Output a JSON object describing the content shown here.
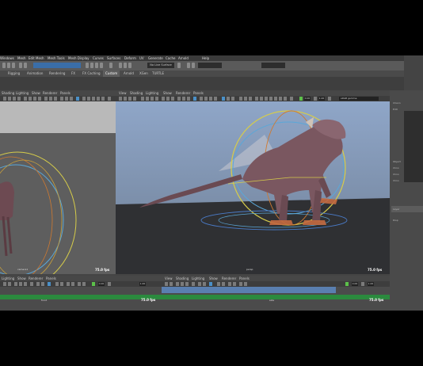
{
  "menubar": {
    "items": [
      "Windows",
      "Mesh",
      "Edit Mesh",
      "Mesh Tools",
      "Mesh Display",
      "Curves",
      "Surfaces",
      "Deform",
      "UV",
      "Generate",
      "Cache",
      "Arnold",
      "Help"
    ]
  },
  "status": {
    "field_value": "No Live Surface"
  },
  "shelf_tabs": {
    "items": [
      "Rigging",
      "Animation",
      "Rendering",
      "FX",
      "FX Caching",
      "Custom",
      "Arnold",
      "XGen",
      "TURTLE"
    ],
    "active": "Custom"
  },
  "panels": {
    "left_menu": [
      "Shading",
      "Lighting",
      "Show",
      "Renderer",
      "Panels"
    ],
    "main_menu": [
      "View",
      "Shading",
      "Lighting",
      "Show",
      "Renderer",
      "Panels"
    ],
    "bottom_left_menu": [
      "Lighting",
      "Show",
      "Renderer",
      "Panels"
    ],
    "bottom_right_menu": [
      "View",
      "Shading",
      "Lighting",
      "Show",
      "Renderer",
      "Panels"
    ]
  },
  "toolbar_fields": {
    "value_a": "0.00",
    "value_b": "1.00",
    "colorspace": "sRGB gamma"
  },
  "viewports": {
    "left_camera": "camera1",
    "left_fps": "75.0 fps",
    "main_camera": "persp",
    "main_fps": "75.0 fps",
    "bottom_left_camera": "front",
    "bottom_left_fps": "75.0 fps",
    "bottom_right_camera": "side",
    "bottom_right_fps": "75.0 fps"
  },
  "right_panel": {
    "items": [
      "Chann",
      "Edit",
      "Object",
      "rhino",
      "rhino",
      "rhino",
      "Layer",
      "Disp"
    ]
  },
  "colors": {
    "viewport_gradient_top": "#8fa6c8",
    "viewport_gradient_bottom": "#6f7f95",
    "ground": "#2f3033",
    "creature": "#7a5760",
    "rig_yellow": "#d6cc4a",
    "rig_blue": "#5aa7d8",
    "rig_orange": "#d07a30",
    "timeline_green": "#2b8a3e"
  }
}
